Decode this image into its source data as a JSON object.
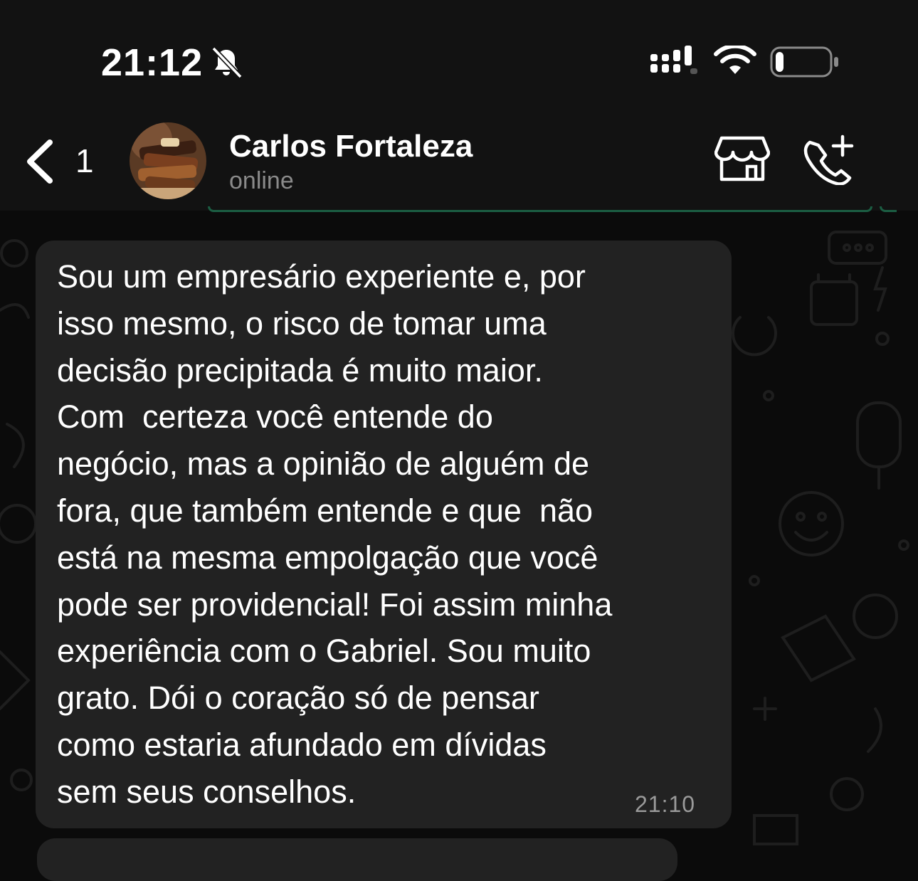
{
  "status_bar": {
    "time": "21:12",
    "icons": [
      "bell-slash-icon",
      "cellular-signal-icon",
      "wifi-icon",
      "battery-icon"
    ],
    "battery_level": 0.15
  },
  "header": {
    "back_icon": "chevron-left-icon",
    "unread_count": "1",
    "contact_name": "Carlos Fortaleza",
    "contact_status": "online",
    "actions": [
      "storefront-icon",
      "add-call-icon"
    ]
  },
  "message": {
    "lines": [
      "Sou um empresário experiente e, por",
      "isso mesmo, o risco de tomar uma",
      "decisão precipitada é muito maior.",
      "Com  certeza você entende do",
      "negócio, mas a opinião de alguém de",
      "fora, que também entende e que  não",
      "está na mesma empolgação que você",
      "pode ser providencial! Foi assim minha",
      "experiência com o Gabriel. Sou muito",
      "grato. Dói o coração só de pensar",
      "como estaria afundado em dívidas",
      "sem seus conselhos."
    ],
    "time": "21:10"
  },
  "colors": {
    "background": "#0b0b0b",
    "bar": "#121212",
    "bubble": "#222222",
    "accent": "#1b5e43",
    "secondary_text": "#8a8a8a"
  }
}
